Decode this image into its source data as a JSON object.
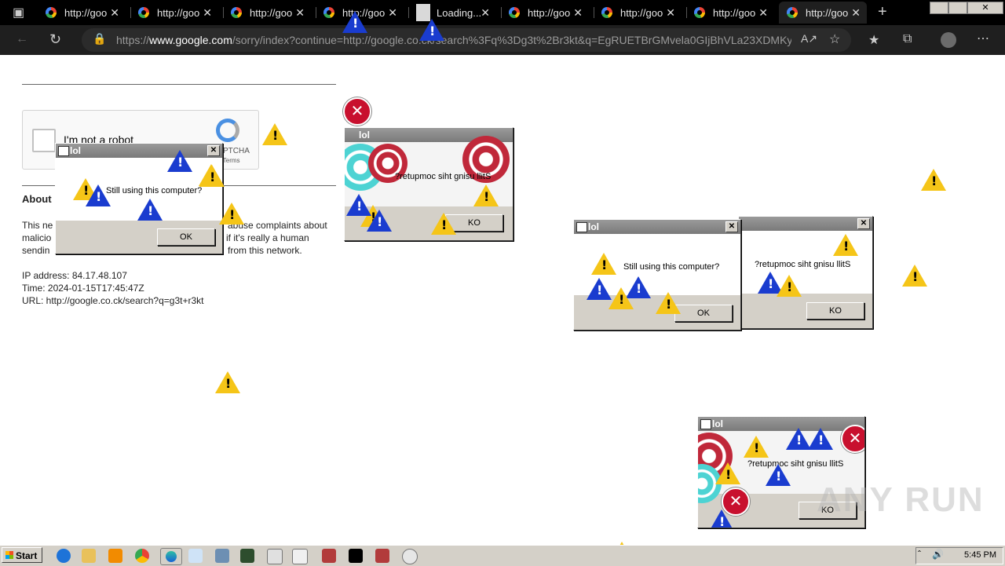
{
  "browser": {
    "tabs": [
      {
        "label": "http://goo",
        "kind": "google"
      },
      {
        "label": "http://goo",
        "kind": "google"
      },
      {
        "label": "http://goo",
        "kind": "google"
      },
      {
        "label": "http://goo",
        "kind": "google"
      },
      {
        "label": "Loading...",
        "kind": "loading"
      },
      {
        "label": "http://goo",
        "kind": "google"
      },
      {
        "label": "http://goo",
        "kind": "google"
      },
      {
        "label": "http://goo",
        "kind": "google"
      },
      {
        "label": "http://goo",
        "kind": "google",
        "active": true
      }
    ],
    "url_prefix": "https://",
    "url_domain": "www.google.com",
    "url_rest": "/sorry/index?continue=http://google.co.ck/search%3Fq%3Dg3t%2Br3kt&q=EgRUETBrGMvela0GIjBhVLa23XDMKy..."
  },
  "page": {
    "captcha_label": "I'm not a robot",
    "captcha_brand": "PTCHA",
    "captcha_links": "- Terms",
    "about_heading": "About",
    "about_line1_left": "This ne",
    "about_line1_right": "abuse complaints about",
    "about_line2_left": "malicio",
    "about_line2_right": "if it's really a human",
    "about_line3_left": "sendin",
    "about_line3_right": "from this network.",
    "ip": "IP address: 84.17.48.107",
    "time": "Time: 2024-01-15T17:45:47Z",
    "url": "URL: http://google.co.ck/search?q=g3t+r3kt"
  },
  "dialogs": [
    {
      "title": "lol",
      "message": "Still using this computer?",
      "button": "OK"
    },
    {
      "title": "lol",
      "message": "?retupmoc siht gnisu llitS",
      "button": "KO"
    },
    {
      "title": "lol",
      "message": "Still using this computer?",
      "button": "OK"
    },
    {
      "title": "",
      "message": "?retupmoc siht gnisu llitS",
      "button": "KO"
    },
    {
      "title": "lol",
      "message": "?retupmoc siht gnisu llitS",
      "button": "KO"
    }
  ],
  "taskbar": {
    "start_label": "Start",
    "clock": "5:45 PM"
  },
  "watermark": "ANY RUN",
  "colors": {
    "warning_yellow": "#f5c518",
    "warning_blue": "#1a3ccf",
    "error_red": "#c8102e",
    "dialog_gray": "#d4d0c8"
  }
}
